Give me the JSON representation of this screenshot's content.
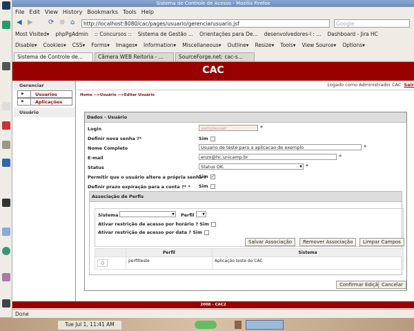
{
  "window": {
    "title": "Sistema de Controle de Acesso - Mozilla Firefox"
  },
  "menu": [
    "File",
    "Edit",
    "View",
    "History",
    "Bookmarks",
    "Tools",
    "Help"
  ],
  "nav": {
    "url": "http://localhost:8080/cac/pages/usuario/gerenciarusuario.jsf",
    "search_placeholder": "Google"
  },
  "bookmarks": [
    "Most Visited▾",
    "phpPgAdmin",
    ":: Concursos ::",
    "Sistema de Gestão ...",
    "Orientações para De...",
    "desenvolvedores-l : ...",
    "Dashboard - Jira HC"
  ],
  "webdev": [
    "Disable▾",
    "Cookies▾",
    "CSS▾",
    "Forms▾",
    "Images▾",
    "Information▾",
    "Miscellaneous▾",
    "Outline▾",
    "Resize▾",
    "Tools▾",
    "View Source▾",
    "Options▾"
  ],
  "tabs": [
    "Sistema de Controle de...",
    "Câmera WEB Reitoria - ...",
    "SourceForge.net: cac-s..."
  ],
  "app": {
    "title": "CAC",
    "logged": "Logado como Administrador CAC",
    "logout": "Sair",
    "breadcrumb": "Home -->Usuário -->Editar Usuário",
    "footer": "2008 - CAC2"
  },
  "sidebar": {
    "group1": "Gerenciar",
    "items": [
      "Usuarios",
      "Aplicações"
    ],
    "group2": "Usuário"
  },
  "form": {
    "title": "Dados - Usuário",
    "login_label": "Login",
    "login_value": "sampleuser",
    "nova_senha_label": "Definir nova senha ?*",
    "sim": "Sim",
    "nome_label": "Nome Completo",
    "nome_value": "Usuario de teste para a aplicacao de exemplo",
    "email_label": "E-mail",
    "email_value": "enzo@hc.unicamp.br",
    "status_label": "Status",
    "status_value": "Status OK.",
    "permitir_label": "Permitir que o usuário altere a própria senha ?",
    "prazo_label": "Definir prazo expiração para a conta ?*   *",
    "required": "*"
  },
  "assoc": {
    "title": "Associação de Perfis",
    "sistema_label": "Sistema",
    "perfil_label": "Perfil",
    "horario_label": "Ativar restrição de acesso por horário ?",
    "data_label": "Ativar restrição de acesso por data ?",
    "salvar": "Salvar Associação",
    "remover": "Remover Associação",
    "limpar": "Limpar Campos",
    "columns": [
      "Perfil",
      "Sistema"
    ],
    "rows": [
      {
        "perfil": "perfilteste",
        "sistema": "Aplicação teste do CAC"
      }
    ]
  },
  "actions": {
    "confirm": "Confirmar Edição",
    "cancel": "Cancelar"
  },
  "status": "Done",
  "clock": "Tue Jul  1, 11:41 AM"
}
